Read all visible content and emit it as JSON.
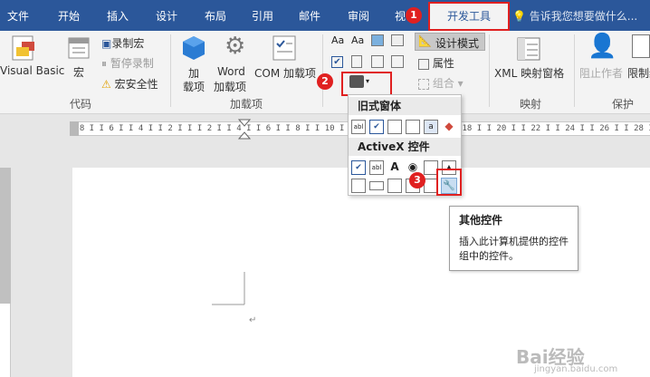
{
  "tabs": [
    {
      "label": "文件"
    },
    {
      "label": "开始"
    },
    {
      "label": "插入"
    },
    {
      "label": "设计"
    },
    {
      "label": "布局"
    },
    {
      "label": "引用"
    },
    {
      "label": "邮件"
    },
    {
      "label": "审阅"
    },
    {
      "label": "视"
    },
    {
      "label": "开发工具"
    }
  ],
  "tell_me": "告诉我您想要做什么...",
  "steps": [
    "1",
    "2",
    "3"
  ],
  "ribbon": {
    "code": {
      "vb": "Visual Basic",
      "macro": "宏",
      "record": "录制宏",
      "pause": "暂停录制",
      "security": "宏安全性",
      "group": "代码"
    },
    "addins": {
      "addin_line1": "加",
      "addin_line2": "载项",
      "word_line1": "Word",
      "word_line2": "加载项",
      "com": "COM 加载项",
      "group": "加载项"
    },
    "controls": {
      "design_mode": "设计模式",
      "properties": "属性",
      "combine": "组合"
    },
    "mapping": {
      "xml": "XML 映射窗格",
      "group": "映射"
    },
    "protect": {
      "block_authors": "阻止作者",
      "restrict": "限制编",
      "group": "保护"
    }
  },
  "ruler": "I 8 I I 6 I I 4 I I 2 I I    I 2 I I 4 I I 6 I I 8 I I 10 I I 12 I I 14 I I 16 I I 18 I I 20 I I 22 I I 24 I I 26 I I 28 I",
  "dropdown": {
    "legacy_header": "旧式窗体",
    "activex_header": "ActiveX 控件"
  },
  "tooltip": {
    "title": "其他控件",
    "desc": "插入此计算机提供的控件组中的控件。"
  },
  "paragraph_mark": "↵",
  "watermark": "Bai经验",
  "watermark_url": "jingyan.baidu.com",
  "colors": {
    "tab_blue": "#2b579a",
    "highlight_red": "#e02020"
  }
}
